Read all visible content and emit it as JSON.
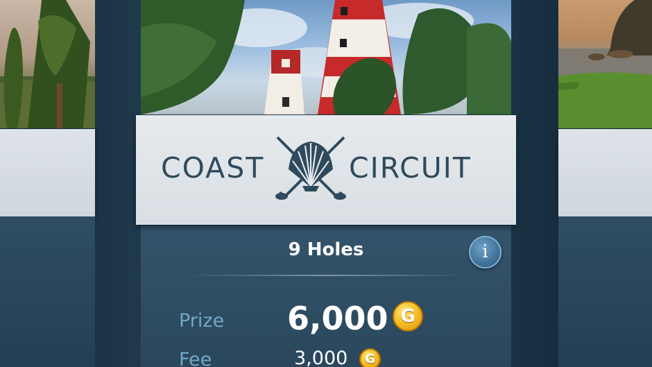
{
  "course": {
    "title_left": "COAST",
    "title_right": "CIRCUIT",
    "holes": "9 Holes",
    "info_glyph": "i"
  },
  "rewards": {
    "prize_label": "Prize",
    "prize_value": "6,000",
    "fee_label": "Fee",
    "fee_value": "3,000",
    "currency_glyph": "G"
  },
  "colors": {
    "title_text": "#2f4a5c",
    "label_blue": "#6fa8c8",
    "coin_gold": "#f7c12a",
    "panel": "#2f4e63"
  },
  "icons": {
    "logo": "shell-crossed-golf-clubs-icon",
    "info": "info-icon",
    "coin": "gold-coin-icon"
  }
}
